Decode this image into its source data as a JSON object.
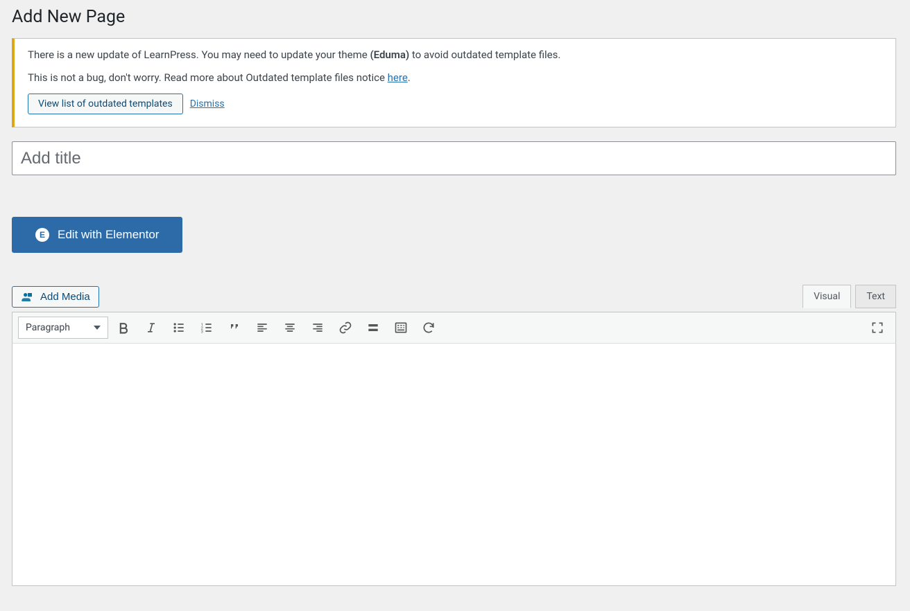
{
  "header": {
    "title": "Add New Page"
  },
  "notice": {
    "line1_pre": "There is a new update of LearnPress. You may need to update your theme ",
    "line1_theme": "(Eduma)",
    "line1_post": " to avoid outdated template files.",
    "line2_pre": "This is not a bug, don't worry. Read more about Outdated template files notice ",
    "line2_link": "here",
    "line2_post": ".",
    "view_button": "View list of outdated templates",
    "dismiss": "Dismiss"
  },
  "title_input": {
    "placeholder": "Add title",
    "value": ""
  },
  "elementor": {
    "label": "Edit with Elementor",
    "icon_letter": "E"
  },
  "media": {
    "add_media": "Add Media"
  },
  "tabs": {
    "visual": "Visual",
    "text": "Text"
  },
  "toolbar": {
    "format": "Paragraph"
  }
}
